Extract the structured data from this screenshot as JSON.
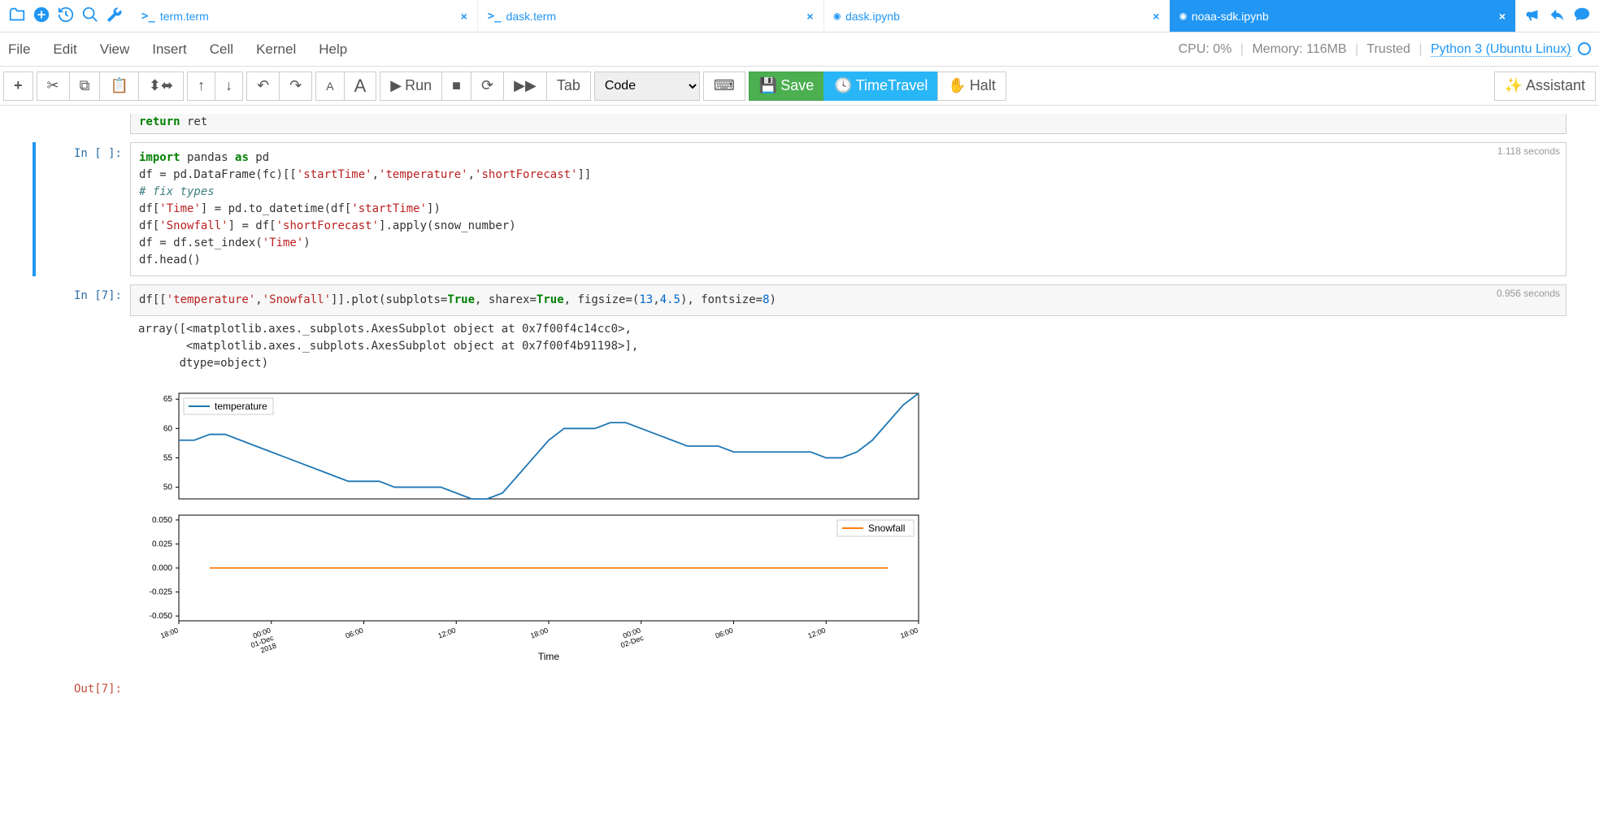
{
  "tabs": [
    {
      "label": "term.term",
      "icon": "terminal"
    },
    {
      "label": "dask.term",
      "icon": "terminal"
    },
    {
      "label": "dask.ipynb",
      "icon": "jupyter"
    },
    {
      "label": "noaa-sdk.ipynb",
      "icon": "jupyter",
      "active": true
    }
  ],
  "menu": [
    "File",
    "Edit",
    "View",
    "Insert",
    "Cell",
    "Kernel",
    "Help"
  ],
  "status": {
    "cpu": "CPU: 0%",
    "memory": "Memory: 116MB",
    "trusted": "Trusted",
    "kernel": "Python 3 (Ubuntu Linux)"
  },
  "toolbar": {
    "run": "Run",
    "tab": "Tab",
    "celltype": "Code",
    "save": "Save",
    "timetravel": "TimeTravel",
    "halt": "Halt",
    "assistant": "Assistant"
  },
  "cells": {
    "prev_tail_kw": "return",
    "prev_tail_rest": " ret",
    "c1": {
      "prompt": "In [ ]:",
      "time": "1.118 seconds",
      "code_html": "<span class=\"kw\">import</span> pandas <span class=\"kw\">as</span> pd\ndf = pd.DataFrame(fc)[[<span class=\"str\">'startTime'</span>,<span class=\"str\">'temperature'</span>,<span class=\"str\">'shortForecast'</span>]]\n<span class=\"cmt\"># fix types</span>\ndf[<span class=\"str\">'Time'</span>] = pd.to_datetime(df[<span class=\"str\">'startTime'</span>])\ndf[<span class=\"str\">'Snowfall'</span>] = df[<span class=\"str\">'shortForecast'</span>].apply(snow_number)\ndf = df.set_index(<span class=\"str\">'Time'</span>)\ndf.head()"
    },
    "c2": {
      "prompt": "In [7]:",
      "time": "0.956 seconds",
      "code_html": "df[[<span class=\"str\">'temperature'</span>,<span class=\"str\">'Snowfall'</span>]].plot(subplots=<span class=\"bool\">True</span>, sharex=<span class=\"bool\">True</span>, figsize=(<span class=\"num\">13</span>,<span class=\"num\">4.5</span>), fontsize=<span class=\"num\">8</span>)",
      "output_text": "array([<matplotlib.axes._subplots.AxesSubplot object at 0x7f00f4c14cc0>,\n       <matplotlib.axes._subplots.AxesSubplot object at 0x7f00f4b91198>],\n      dtype=object)"
    },
    "out7": {
      "prompt": "Out[7]:"
    }
  },
  "chart_data": [
    {
      "type": "line",
      "title": "",
      "legend": "temperature",
      "xlabel": "",
      "ylabel": "",
      "ylim": [
        48,
        66
      ],
      "yticks": [
        50,
        55,
        60,
        65
      ],
      "x_categories": [
        "18:00",
        "00:00 01-Dec 2018",
        "06:00",
        "12:00",
        "18:00",
        "00:00 02-Dec",
        "06:00",
        "12:00",
        "18:00"
      ],
      "series": [
        {
          "name": "temperature",
          "color": "#1f77b4",
          "x": [
            0,
            1,
            2,
            3,
            4,
            5,
            6,
            7,
            8,
            9,
            10,
            11,
            12,
            13,
            14,
            15,
            16,
            17,
            18,
            19,
            20,
            21,
            22,
            23,
            24,
            25,
            26,
            27,
            28,
            29,
            30,
            31,
            32,
            33,
            34,
            35,
            36,
            37,
            38,
            39,
            40,
            41,
            42,
            43,
            44,
            45,
            46,
            47,
            48
          ],
          "values": [
            58,
            58,
            59,
            59,
            58,
            57,
            56,
            55,
            54,
            53,
            52,
            51,
            51,
            51,
            50,
            50,
            50,
            50,
            49,
            48,
            48,
            49,
            52,
            55,
            58,
            60,
            60,
            60,
            61,
            61,
            60,
            59,
            58,
            57,
            57,
            57,
            56,
            56,
            56,
            56,
            56,
            56,
            55,
            55,
            56,
            58,
            61,
            64,
            66
          ]
        }
      ]
    },
    {
      "type": "line",
      "title": "",
      "legend": "Snowfall",
      "xlabel": "Time",
      "ylabel": "",
      "ylim": [
        -0.055,
        0.055
      ],
      "yticks": [
        -0.05,
        -0.025,
        0.0,
        0.025,
        0.05
      ],
      "x_categories": [
        "18:00",
        "00:00 01-Dec 2018",
        "06:00",
        "12:00",
        "18:00",
        "00:00 02-Dec",
        "06:00",
        "12:00",
        "18:00"
      ],
      "series": [
        {
          "name": "Snowfall",
          "color": "#ff7f0e",
          "x": [
            0,
            48
          ],
          "values": [
            0,
            0
          ]
        }
      ]
    }
  ]
}
